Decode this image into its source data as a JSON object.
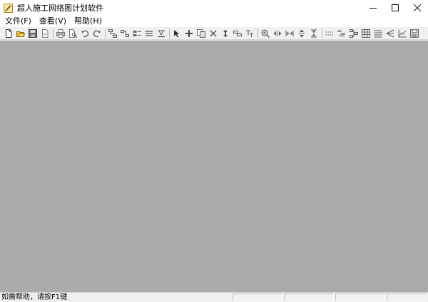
{
  "window": {
    "title": "超人施工网络图计划软件",
    "controls": [
      "minimize-icon",
      "maximize-icon",
      "close-icon"
    ]
  },
  "menu": [
    {
      "label": "文件(F)"
    },
    {
      "label": "查看(V)"
    },
    {
      "label": "帮助(H)"
    }
  ],
  "toolbar": {
    "groups": [
      [
        "new-file-icon",
        "open-folder-icon",
        "save-icon",
        "document-icon"
      ],
      [
        "print-icon",
        "print-preview-icon",
        "undo-icon",
        "redo-icon"
      ],
      [
        "network-node-icon",
        "network-link-icon",
        "bar-split-icon",
        "list-lines-icon",
        "baseline-icon"
      ],
      [
        "pointer-icon",
        "plus-icon",
        "copy-icon",
        "delete-icon",
        "vertical-move-icon",
        "bar-shift-icon",
        "text-tool-icon"
      ],
      [
        "zoom-icon",
        "horizontal-expand-icon",
        "horizontal-compress-icon",
        "vertical-expand-icon",
        "vertical-compress-icon"
      ],
      [
        "dotted-line-icon",
        "chart-a-icon",
        "chart-b-icon",
        "grid-table-icon",
        "align-lines-icon",
        "indent-icon",
        "bar-chart-icon",
        "floppy-icon"
      ]
    ]
  },
  "status": {
    "help_text": "如需帮助，请按F1键"
  },
  "colors": {
    "workspace": "#ababab",
    "chrome": "#f0f0f0",
    "titlebar": "#ffffff"
  }
}
